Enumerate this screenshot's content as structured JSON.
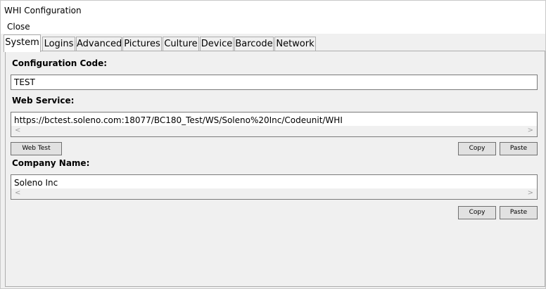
{
  "window": {
    "title": "WHI Configuration"
  },
  "menu": {
    "close": "Close"
  },
  "tabs": [
    {
      "label": "System",
      "active": true
    },
    {
      "label": "Logins"
    },
    {
      "label": "Advanced"
    },
    {
      "label": "Pictures"
    },
    {
      "label": "Culture"
    },
    {
      "label": "Device"
    },
    {
      "label": "Barcode"
    },
    {
      "label": "Network"
    }
  ],
  "system": {
    "config_code_label": "Configuration Code:",
    "config_code_value": "TEST",
    "web_service_label": "Web Service:",
    "web_service_value": "https://bctest.soleno.com:18077/BC180_Test/WS/Soleno%20Inc/Codeunit/WHI",
    "web_test_button": "Web Test",
    "copy_button": "Copy",
    "paste_button": "Paste",
    "company_name_label": "Company Name:",
    "company_name_value": "Soleno Inc"
  },
  "icons": {
    "scroll_left": "chevron-left-icon",
    "scroll_right": "chevron-right-icon"
  }
}
